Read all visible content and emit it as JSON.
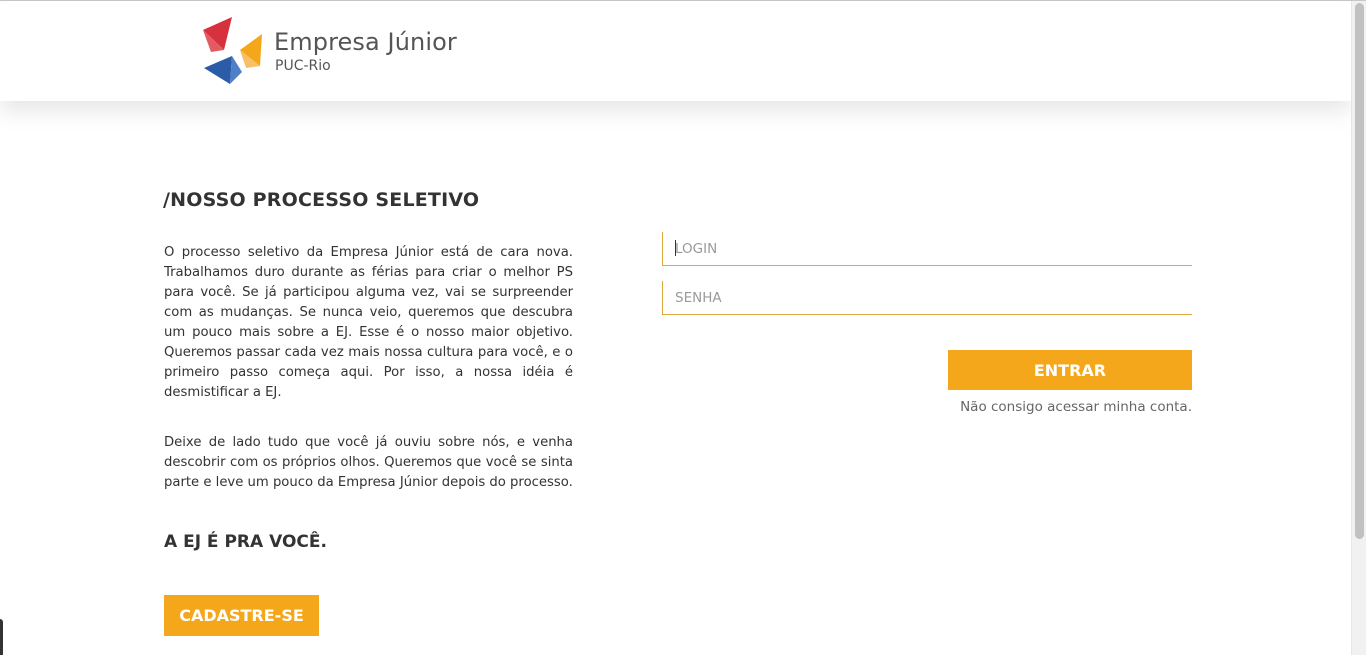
{
  "header": {
    "logo": {
      "name": "Empresa Júnior",
      "sub": "PUC-Rio",
      "colors": {
        "red": "#d7313e",
        "yellow": "#f5a71c",
        "blue": "#2a5ca8"
      }
    }
  },
  "main": {
    "section_title": "/NOSSO PROCESSO SELETIVO",
    "paragraph1": "O processo seletivo da Empresa Júnior está de cara nova. Trabalhamos duro durante as férias para criar o melhor PS para você. Se já participou alguma vez, vai se surpreender com as mudanças. Se nunca veio, queremos que descubra um pouco mais sobre a EJ. Esse é o nosso maior objetivo. Queremos passar cada vez mais nossa cultura para você, e o primeiro passo começa aqui. Por isso, a nossa idéia é desmistificar a EJ.",
    "paragraph2": "Deixe de lado tudo que você já ouviu sobre nós, e venha descobrir com os próprios olhos. Queremos que você se sinta parte e leve um pouco da Empresa Júnior depois do processo.",
    "tagline": "A EJ É PRA VOCÊ.",
    "signup_label": "CADASTRE-SE"
  },
  "form": {
    "login_placeholder": "LOGIN",
    "login_value": "",
    "password_placeholder": "SENHA",
    "password_value": "",
    "submit_label": "ENTRAR",
    "forgot_label": "Não consigo acessar minha conta."
  },
  "theme": {
    "accent": "#f5a71c",
    "text": "#333333",
    "field_border": "#e0a83a"
  }
}
